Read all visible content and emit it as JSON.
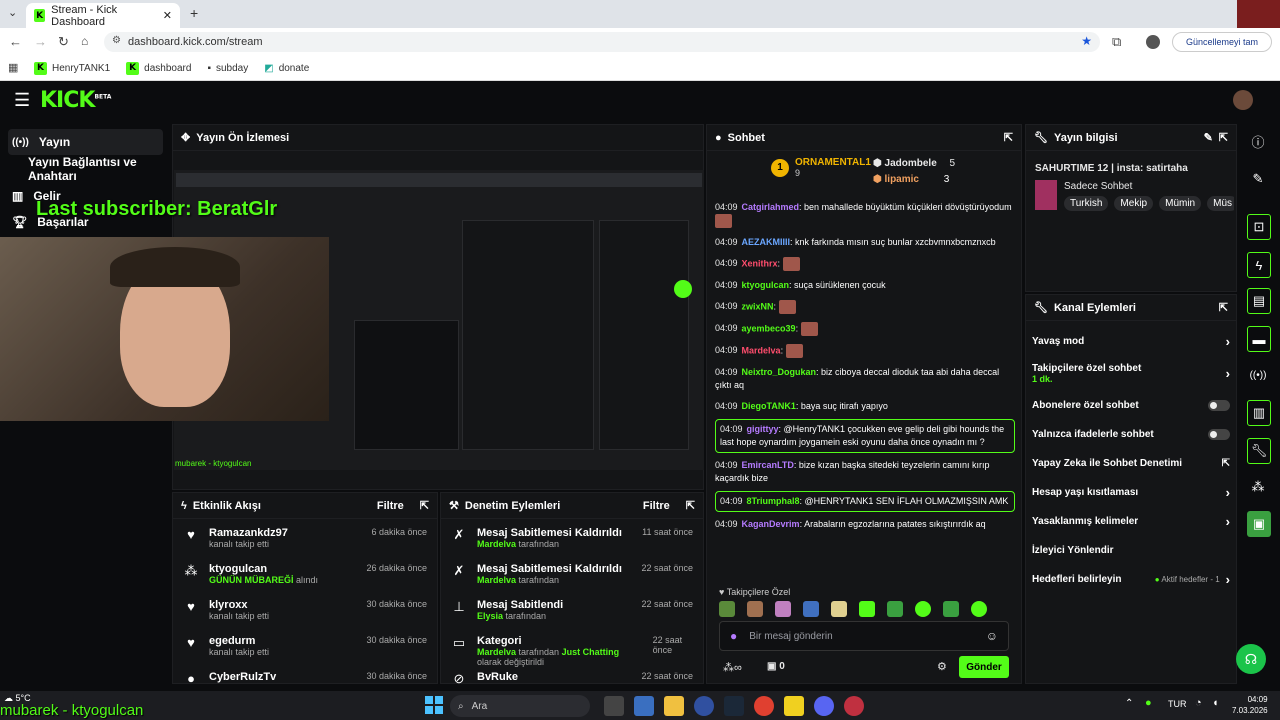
{
  "browser": {
    "tab_title": "Stream - Kick Dashboard",
    "url": "dashboard.kick.com/stream",
    "update_button": "Güncellemeyi tam",
    "bookmarks": [
      "HenryTANK1",
      "dashboard",
      "subday",
      "donate"
    ]
  },
  "app": {
    "logo": "KICK",
    "beta": "BETA"
  },
  "sidebar": {
    "items": [
      {
        "label": "Yayın"
      },
      {
        "label": "Yayın Bağlantısı ve Anahtarı"
      },
      {
        "label": "Gelir"
      },
      {
        "label": "Başarılar"
      }
    ]
  },
  "overlay": {
    "last_subscriber": "Last subscriber: BeratGlr",
    "bottom_ticker": "mubarek - ktyogulcan",
    "preview_ticker": "mubarek - ktyogulcan"
  },
  "preview": {
    "title": "Yayın Ön İzlemesi"
  },
  "chat": {
    "title": "Sohbet",
    "leaders": [
      {
        "rank": "1",
        "name": "ORNAMENTAL1",
        "count": "9"
      },
      {
        "name": "Jadombele",
        "count": "5"
      },
      {
        "name": "lipamic",
        "count": "3"
      }
    ],
    "messages": [
      {
        "time": "04:09",
        "user": "Catgirlahmed",
        "color": "#b57bff",
        "text": ": ben mahallede büyüktüm küçükleri dövüştürüyodum",
        "emote": true
      },
      {
        "time": "04:09",
        "user": "AEZAKMIIII",
        "color": "#6aa6ff",
        "text": ": knk farkında mısın suç bunlar xzcbvmnxbcmznxcb"
      },
      {
        "time": "04:09",
        "user": "Xenithrx",
        "color": "#ff4d6d",
        "text": ":",
        "emote": true
      },
      {
        "time": "04:09",
        "user": "ktyogulcan",
        "color": "#53fc18",
        "text": ": suça sürüklenen çocuk"
      },
      {
        "time": "04:09",
        "user": "zwixNN",
        "color": "#53fc18",
        "text": ":",
        "emote": true
      },
      {
        "time": "04:09",
        "user": "ayembeco39",
        "color": "#53fc18",
        "text": ":",
        "emote": true
      },
      {
        "time": "04:09",
        "user": "Mardelva",
        "color": "#ff4d6d",
        "text": ":",
        "emote": true
      },
      {
        "time": "04:09",
        "user": "Neixtro_Dogukan",
        "color": "#53fc18",
        "text": ": biz ciboya deccal dioduk taa abi daha deccal çıktı aq"
      },
      {
        "time": "04:09",
        "user": "DiegoTANK1",
        "color": "#53fc18",
        "text": ": baya suç itirafı yapıyo"
      },
      {
        "time": "04:09",
        "user": "gigittyy",
        "color": "#b57bff",
        "text": ": @HenryTANK1 çocukken eve gelip deli gibi hounds the last hope oynardım joygamein eski oyunu daha önce oynadın mı ?",
        "hl": true
      },
      {
        "time": "04:09",
        "user": "EmircanLTD",
        "color": "#b57bff",
        "text": ": bize kızan başka sitedeki teyzelerin camını kırıp kaçardık bize"
      },
      {
        "time": "04:09",
        "user": "8Triumphal8",
        "color": "#53fc18",
        "text": ": @HENRYTANK1 SEN İFLAH OLMAZMIŞSIN AMK",
        "hl": true
      },
      {
        "time": "04:09",
        "user": "KaganDevrim",
        "color": "#b57bff",
        "text": ": Arabaların egzozlarına patates sıkıştırırdık aq"
      }
    ],
    "followers_only": "Takipçilere Özel",
    "input_placeholder": "Bir mesaj gönderin",
    "points": "0",
    "send": "Gönder"
  },
  "stream_info": {
    "title": "Yayın bilgisi",
    "stream_title": "SAHURTIME 12 | insta: satirtaha",
    "category": "Sadece Sohbet",
    "tags": [
      "Turkish",
      "Mekip",
      "Mümin",
      "Müs"
    ]
  },
  "channel_actions": {
    "title": "Kanal Eylemleri",
    "items": [
      {
        "label": "Yavaş mod"
      },
      {
        "label": "Takipçilere özel sohbet",
        "sub": "1 dk."
      },
      {
        "label": "Abonelere özel sohbet"
      },
      {
        "label": "Yalnızca ifadelerle sohbet"
      },
      {
        "label": "Yapay Zeka ile Sohbet Denetimi"
      },
      {
        "label": "Hesap yaşı kısıtlaması"
      },
      {
        "label": "Yasaklanmış kelimeler"
      },
      {
        "label": "İzleyici Yönlendir"
      },
      {
        "label": "Hedefleri belirleyin",
        "sub": "Aktif hedefler - 1"
      }
    ]
  },
  "activity": {
    "title": "Etkinlik Akışı",
    "filter": "Filtre",
    "items": [
      {
        "name": "Ramazankdz97",
        "sub": "kanalı takip etti",
        "time": "6 dakika önce"
      },
      {
        "name": "ktyogulcan",
        "sub_green": "GÜNÜN MÜBAREĞİ",
        "sub": " alındı",
        "time": "26 dakika önce"
      },
      {
        "name": "klyroxx",
        "sub": "kanalı takip etti",
        "time": "30 dakika önce"
      },
      {
        "name": "egedurm",
        "sub": "kanalı takip etti",
        "time": "30 dakika önce"
      },
      {
        "name": "CyberRulzTv",
        "sub": "",
        "time": "30 dakika önce"
      }
    ]
  },
  "moderation": {
    "title": "Denetim Eylemleri",
    "filter": "Filtre",
    "items": [
      {
        "name": "Mesaj Sabitlemesi Kaldırıldı",
        "user": "Mardelva",
        "sub": " tarafından",
        "time": "11 saat önce"
      },
      {
        "name": "Mesaj Sabitlemesi Kaldırıldı",
        "user": "Mardelva",
        "sub": " tarafından",
        "time": "22 saat önce"
      },
      {
        "name": "Mesaj Sabitlendi",
        "user": "Elysia",
        "sub": " tarafından",
        "time": "22 saat önce"
      },
      {
        "name": "Kategori",
        "user": "Mardelva",
        "sub": " tarafından ",
        "extra": "Just Chatting",
        "sub2": " olarak değiştirildi",
        "time": "22 saat önce"
      },
      {
        "name": "BvRuke",
        "user": "",
        "sub": "",
        "time": "22 saat önce"
      }
    ]
  },
  "taskbar": {
    "weather": "5°C",
    "search": "Ara",
    "lang": "TUR",
    "time": "04:09",
    "date": "7.03.2026"
  },
  "colors": {
    "accent": "#53fc18",
    "panel": "#141517",
    "bg": "#0b0c0e"
  }
}
